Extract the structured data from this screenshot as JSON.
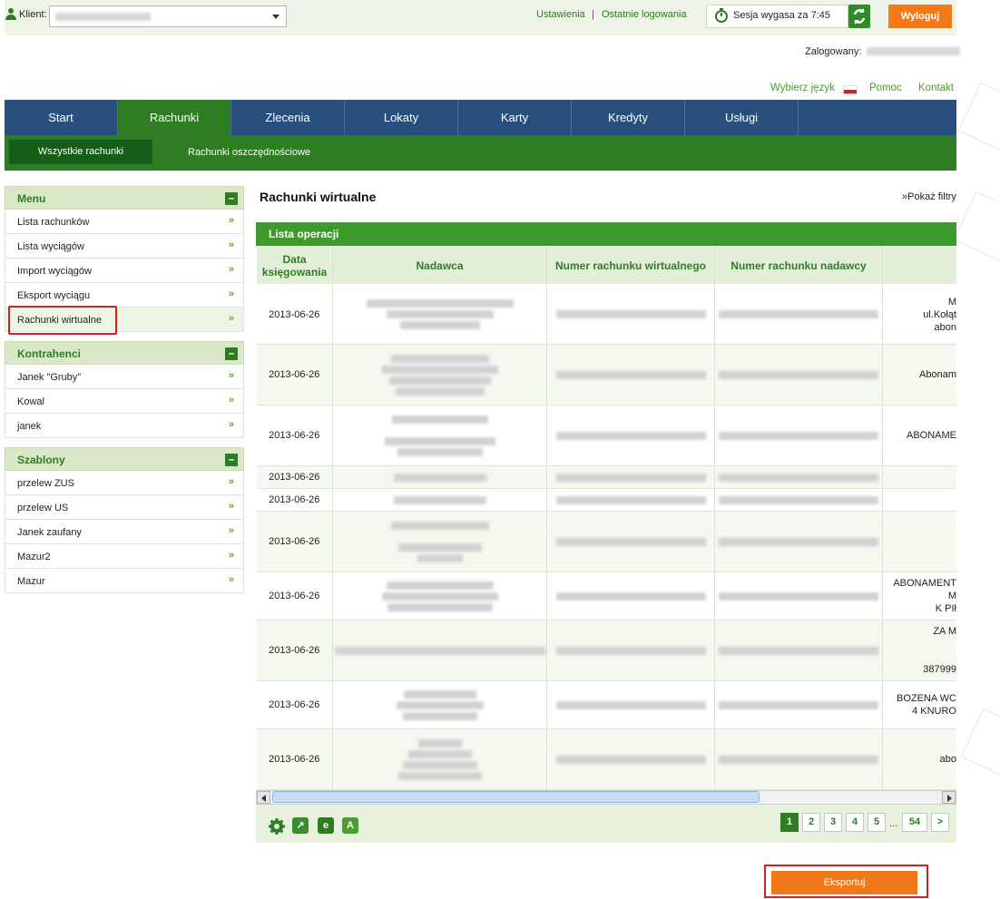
{
  "header": {
    "client_label": "Klient:",
    "settings_link": "Ustawienia",
    "separator": "|",
    "last_logins_link": "Ostatnie logowania",
    "session_text": "Sesja wygasa za 7:45",
    "logout_label": "Wyloguj",
    "logged_label": "Zalogowany:",
    "language_link": "Wybierz język",
    "help_link": "Pomoc",
    "contact_link": "Kontakt"
  },
  "main_nav": [
    "Start",
    "Rachunki",
    "Zlecenia",
    "Lokaty",
    "Karty",
    "Kredyty",
    "Usługi"
  ],
  "main_nav_active": "Rachunki",
  "sub_nav": [
    "Wszystkie rachunki",
    "Rachunki oszczędnościowe"
  ],
  "sidebar": {
    "menu_title": "Menu",
    "menu_items": [
      "Lista rachunków",
      "Lista wyciągów",
      "Import wyciągów",
      "Eksport wyciągu",
      "Rachunki wirtualne"
    ],
    "contractors_title": "Kontrahenci",
    "contractors_items": [
      "Janek \"Gruby\"",
      "Kowal",
      "janek"
    ],
    "templates_title": "Szablony",
    "templates_items": [
      "przelew ZUS",
      "przelew US",
      "Janek zaufany",
      "Mazur2",
      "Mazur"
    ],
    "collapse_symbol": "–",
    "chevron": "»"
  },
  "content": {
    "title": "Rachunki wirtualne",
    "filters_link": "»Pokaż filtry",
    "list_title": "Lista operacji",
    "columns": [
      "Data księgowania",
      "Nadawca",
      "Numer rachunku wirtualnego",
      "Numer rachunku nadawcy"
    ],
    "rows": [
      {
        "date": "2013-06-26",
        "note": "M\nul.Kołąt\nabon"
      },
      {
        "date": "2013-06-26",
        "note": "Abonam"
      },
      {
        "date": "2013-06-26",
        "note": "ABONAME"
      },
      {
        "date": "2013-06-26",
        "note": ""
      },
      {
        "date": "2013-06-26",
        "note": ""
      },
      {
        "date": "2013-06-26",
        "note": ""
      },
      {
        "date": "2013-06-26",
        "note": "ABONAMENT M\nK PIł"
      },
      {
        "date": "2013-06-26",
        "note": "ZA M\n\n\n387999"
      },
      {
        "date": "2013-06-26",
        "note": "BOZENA WC\n4 KNURO"
      },
      {
        "date": "2013-06-26",
        "note": "abo"
      }
    ]
  },
  "pagination": {
    "pages": [
      "1",
      "2",
      "3",
      "4",
      "5"
    ],
    "ellipsis": "...",
    "last": "54",
    "next": ">",
    "current": "1"
  },
  "export_label": "Eksportuj",
  "colors": {
    "nav_blue": "#284f7d",
    "green": "#2e7d22",
    "orange": "#f47a19"
  }
}
